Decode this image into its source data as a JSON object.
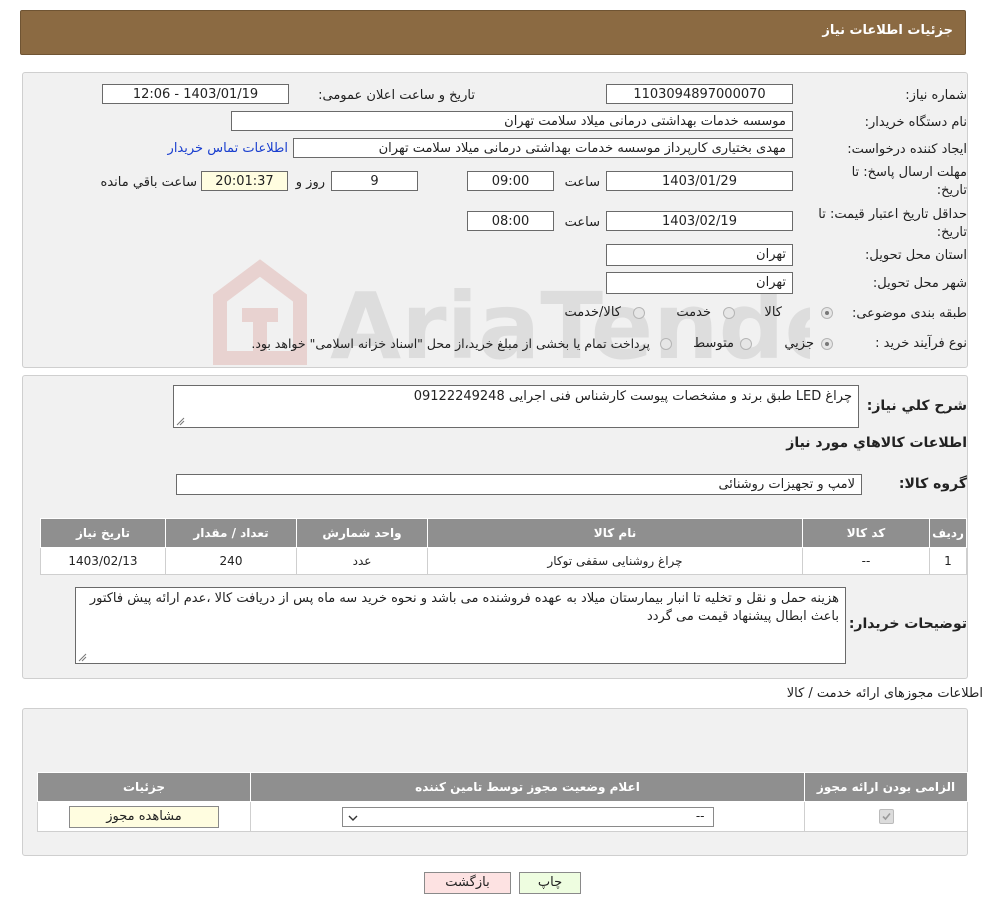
{
  "header": {
    "title": "جزئیات اطلاعات نیاز"
  },
  "form": {
    "need_number_label": "شماره نیاز:",
    "need_number_value": "1103094897000070",
    "announce_label": "تاریخ و ساعت اعلان عمومی:",
    "announce_value": "1403/01/19 - 12:06",
    "buyer_org_label": "نام دستگاه خریدار:",
    "buyer_org_value": "موسسه خدمات بهداشتی درمانی میلاد سلامت تهران",
    "requester_label": "ایجاد کننده درخواست:",
    "requester_value": "مهدی بختیاری کارپرداز موسسه خدمات بهداشتی درمانی میلاد سلامت تهران",
    "contact_link": "اطلاعات تماس خریدار",
    "deadline_label_1": "مهلت ارسال پاسخ: تا",
    "deadline_label_2": "تاریخ:",
    "deadline_date": "1403/01/29",
    "time_label": "ساعت",
    "deadline_time": "09:00",
    "days_value": "9",
    "days_label": "روز و",
    "remaining_value": "20:01:37",
    "remaining_label": "ساعت باقي مانده",
    "validity_label_1": "حداقل تاریخ اعتبار قیمت: تا",
    "validity_label_2": "تاریخ:",
    "validity_date": "1403/02/19",
    "validity_time": "08:00",
    "province_label": "استان محل تحویل:",
    "province_value": "تهران",
    "city_label": "شهر محل تحویل:",
    "city_value": "تهران",
    "category_label": "طبقه بندی موضوعی:",
    "category_options": [
      "کالا",
      "خدمت",
      "کالا/خدمت"
    ],
    "process_label": "نوع فرآیند خرید :",
    "process_options": [
      "جزیي",
      "متوسط"
    ],
    "process_note": "پرداخت تمام یا بخشی از مبلغ خرید،از محل \"اسناد خزانه اسلامی\" خواهد بود."
  },
  "details": {
    "description_label": "شرح کلي نیاز:",
    "description_value": "چراغ LED طبق برند و مشخصات پیوست کارشناس فنی اجرایی 09122249248",
    "goods_info_title": "اطلاعات کالاهاي مورد نیاز",
    "goods_group_label": "گروه کالا:",
    "goods_group_value": "لامپ و تجهیزات روشنائی",
    "table": {
      "headers": [
        "رديف",
        "کد کالا",
        "نام کالا",
        "واحد شمارش",
        "تعداد / مقدار",
        "تاریخ نیاز"
      ],
      "rows": [
        [
          "1",
          "--",
          "چراغ روشنایی سقفی توکار",
          "عدد",
          "240",
          "1403/02/13"
        ]
      ]
    },
    "buyer_notes_label": "توضیحات خریدار:",
    "buyer_notes_value": "هزینه حمل و نقل و تخلیه تا انبار بیمارستان میلاد به عهده فروشنده می باشد و نحوه خرید سه ماه پس از دریافت کالا ،عدم ارائه پیش فاکتور باعث ابطال پیشنهاد قیمت می گردد"
  },
  "licenses": {
    "title": "اطلاعات مجوزهای ارائه خدمت / کالا",
    "headers": [
      "الزامی بودن ارائه مجوز",
      "اعلام وضعیت مجوز توسط تامین کننده",
      "جزئیات"
    ],
    "select_value": "--",
    "view_button": "مشاهده مجوز"
  },
  "buttons": {
    "print": "چاپ",
    "back": "بازگشت"
  },
  "watermark_text": "AriaTender.neT"
}
